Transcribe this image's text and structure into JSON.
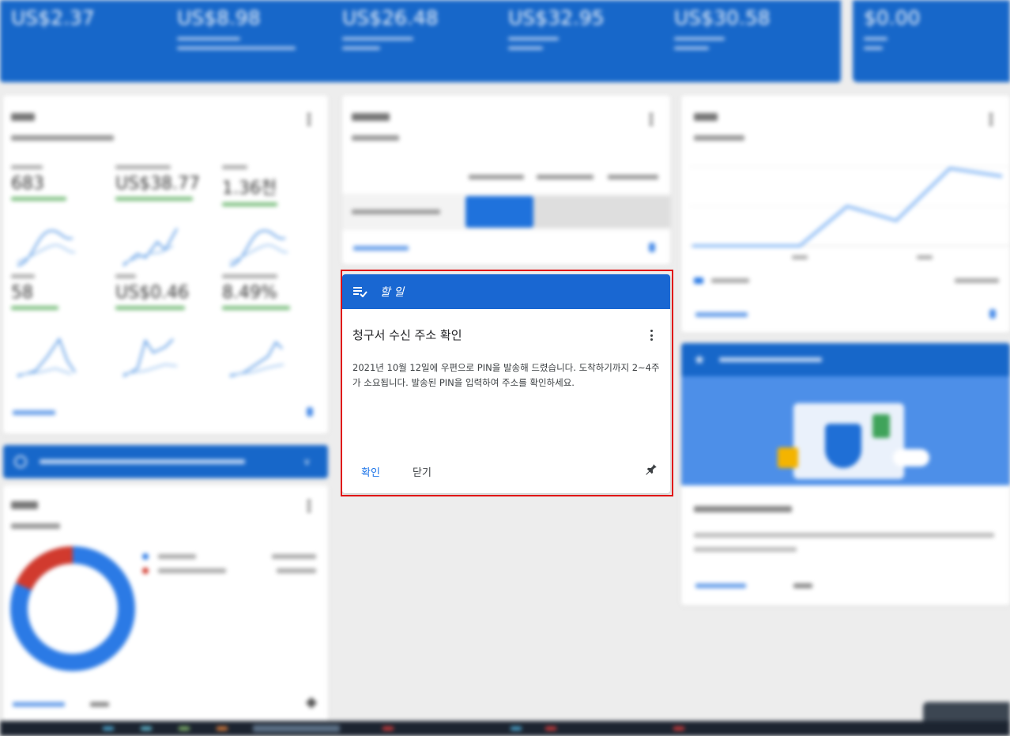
{
  "stats": [
    {
      "value": "US$2.37"
    },
    {
      "value": "US$8.98"
    },
    {
      "value": "US$26.48"
    },
    {
      "value": "US$32.95"
    },
    {
      "value": "US$30.58"
    },
    {
      "value": "$0.00"
    }
  ],
  "todo": {
    "header": "할 일",
    "title": "청구서 수신 주소 확인",
    "description": "2021년 10월 12일에 우편으로 PIN을 발송해 드렸습니다. 도착하기까지 2~4주가 소요됩니다. 발송된 PIN을 입력하여 주소를 확인하세요.",
    "confirm_label": "확인",
    "close_label": "닫기",
    "header_icon": "playlist-check-icon",
    "menu_icon": "more-vert-icon",
    "pin_icon": "pin-icon"
  },
  "performance": {
    "metrics": [
      {
        "value": "683"
      },
      {
        "value": "US$38.77"
      },
      {
        "value": "1.36천"
      },
      {
        "value": "58"
      },
      {
        "value": "US$0.46"
      },
      {
        "value": "8.49%"
      }
    ]
  },
  "colors": {
    "brand_blue": "#1967d2",
    "focus_frame": "#e01010"
  }
}
